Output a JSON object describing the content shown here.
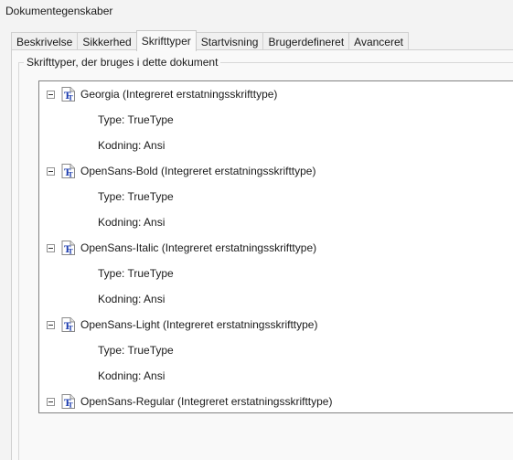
{
  "window": {
    "title": "Dokumentegenskaber"
  },
  "tabs": [
    {
      "label": "Beskrivelse",
      "active": false
    },
    {
      "label": "Sikkerhed",
      "active": false
    },
    {
      "label": "Skrifttyper",
      "active": true
    },
    {
      "label": "Startvisning",
      "active": false
    },
    {
      "label": "Brugerdefineret",
      "active": false
    },
    {
      "label": "Avanceret",
      "active": false
    }
  ],
  "fonts_group": {
    "label": "Skrifttyper, der bruges i dette dokument",
    "fonts": [
      {
        "name": "Georgia (Integreret erstatningsskrifttype)",
        "type": "Type: TrueType",
        "encoding": "Kodning: Ansi",
        "expanded": true
      },
      {
        "name": "OpenSans-Bold (Integreret erstatningsskrifttype)",
        "type": "Type: TrueType",
        "encoding": "Kodning: Ansi",
        "expanded": true
      },
      {
        "name": "OpenSans-Italic (Integreret erstatningsskrifttype)",
        "type": "Type: TrueType",
        "encoding": "Kodning: Ansi",
        "expanded": true
      },
      {
        "name": "OpenSans-Light (Integreret erstatningsskrifttype)",
        "type": "Type: TrueType",
        "encoding": "Kodning: Ansi",
        "expanded": true
      },
      {
        "name": "OpenSans-Regular (Integreret erstatningsskrifttype)",
        "expanded": true
      }
    ]
  },
  "icons": {
    "font_node": "truetype-font-icon",
    "toggle": "collapse-minus-icon"
  },
  "colors": {
    "icon_blue": "#1f3fb0",
    "tree_border": "#828282",
    "background": "#f3f3f3"
  }
}
